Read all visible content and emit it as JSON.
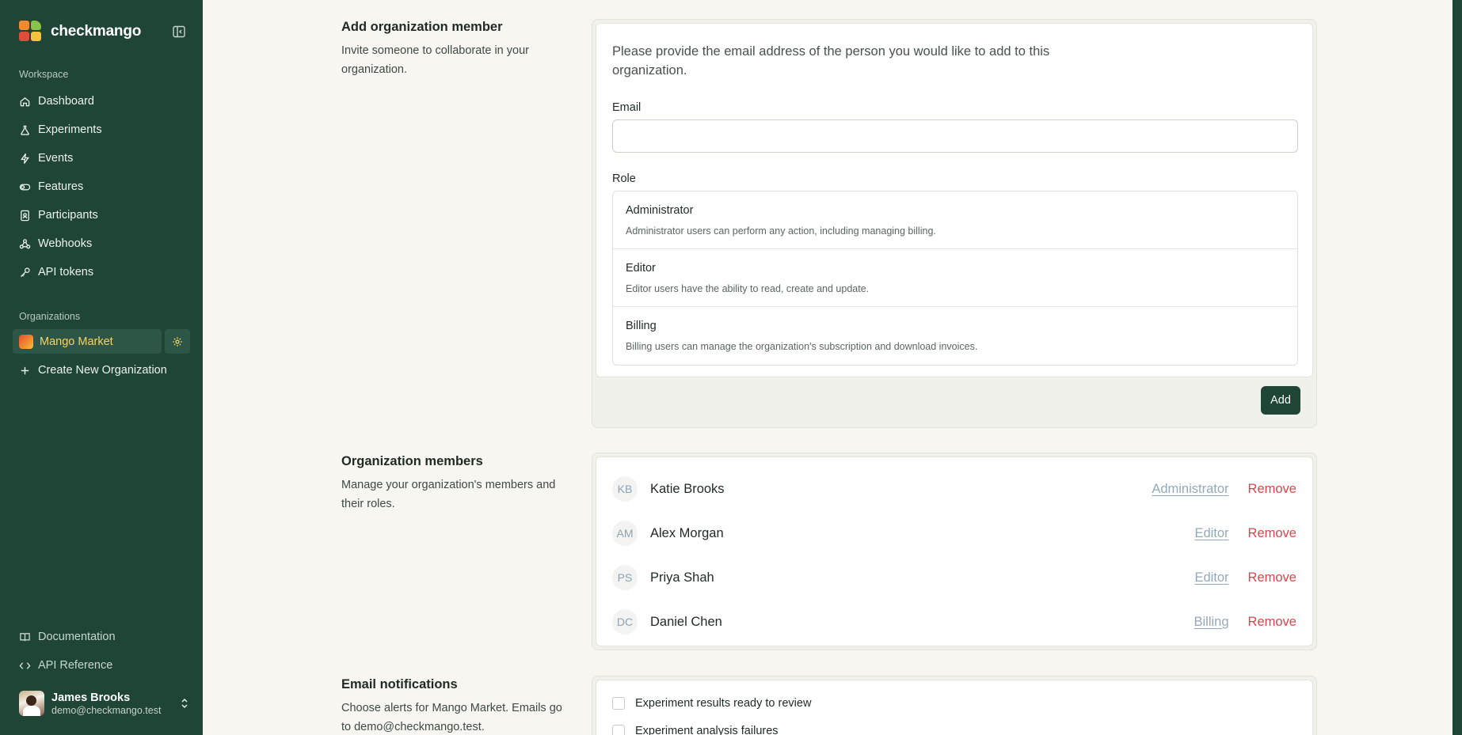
{
  "sidebar": {
    "brand": "checkmango",
    "workspace_label": "Workspace",
    "nav": [
      {
        "label": "Dashboard",
        "icon": "home-icon"
      },
      {
        "label": "Experiments",
        "icon": "flask-icon"
      },
      {
        "label": "Events",
        "icon": "bolt-icon"
      },
      {
        "label": "Features",
        "icon": "toggle-icon"
      },
      {
        "label": "Participants",
        "icon": "id-badge-icon"
      },
      {
        "label": "Webhooks",
        "icon": "webhook-icon"
      },
      {
        "label": "API tokens",
        "icon": "key-icon"
      }
    ],
    "organizations_label": "Organizations",
    "current_org": "Mango Market",
    "create_org": "Create New Organization",
    "footer": [
      {
        "label": "Documentation",
        "icon": "book-icon"
      },
      {
        "label": "API Reference",
        "icon": "code-icon"
      }
    ],
    "user": {
      "name": "James Brooks",
      "email": "demo@checkmango.test"
    }
  },
  "add_member": {
    "title": "Add organization member",
    "description": "Invite someone to collaborate in your organization.",
    "intro": "Please provide the email address of the person you would like to add to this organization.",
    "email_label": "Email",
    "email_value": "",
    "role_label": "Role",
    "roles": [
      {
        "name": "Administrator",
        "description": "Administrator users can perform any action, including managing billing."
      },
      {
        "name": "Editor",
        "description": "Editor users have the ability to read, create and update."
      },
      {
        "name": "Billing",
        "description": "Billing users can manage the organization's subscription and download invoices."
      }
    ],
    "add_button": "Add"
  },
  "members": {
    "title": "Organization members",
    "description": "Manage your organization's members and their roles.",
    "remove_label": "Remove",
    "list": [
      {
        "initials": "KB",
        "name": "Katie Brooks",
        "role": "Administrator"
      },
      {
        "initials": "AM",
        "name": "Alex Morgan",
        "role": "Editor"
      },
      {
        "initials": "PS",
        "name": "Priya Shah",
        "role": "Editor"
      },
      {
        "initials": "DC",
        "name": "Daniel Chen",
        "role": "Billing"
      }
    ]
  },
  "notifications": {
    "title": "Email notifications",
    "description": "Choose alerts for Mango Market. Emails go to demo@checkmango.test.",
    "options": [
      {
        "label": "Experiment results ready to review"
      },
      {
        "label": "Experiment analysis failures"
      }
    ]
  },
  "colors": {
    "sidebar_bg": "#1e4536",
    "accent_yellow": "#f2d36b",
    "danger": "#d9454f",
    "muted_link": "#93a9ba"
  }
}
